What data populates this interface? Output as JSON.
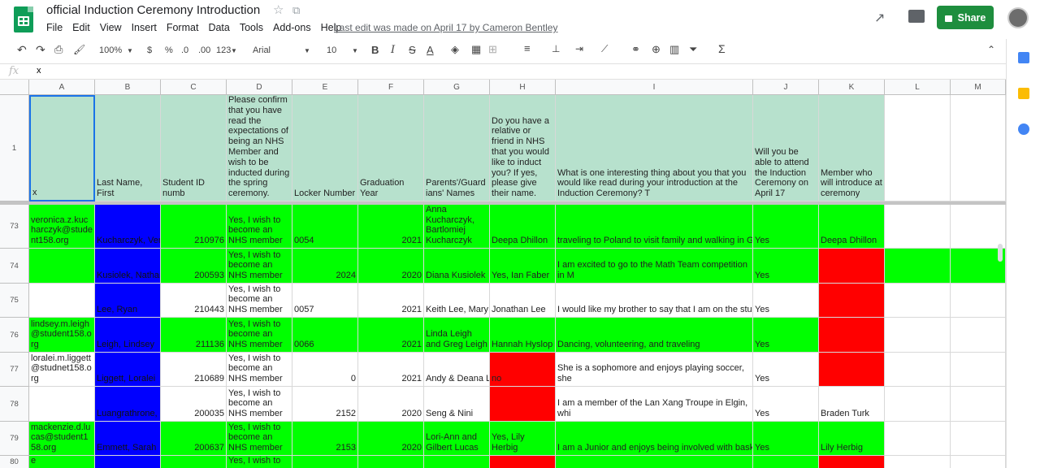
{
  "app": {
    "title": "official Induction Ceremony Introduction",
    "last_edit": "Last edit was made on April 17 by Cameron Bentley",
    "share_label": "Share"
  },
  "menu": [
    "File",
    "Edit",
    "View",
    "Insert",
    "Format",
    "Data",
    "Tools",
    "Add-ons",
    "Help"
  ],
  "toolbar": {
    "zoom": "100%",
    "currency": "$",
    "percent": "%",
    "dec_less": ".0",
    "dec_more": ".00",
    "format_more": "123",
    "font": "Arial",
    "size": "10"
  },
  "formula": {
    "label": "fx",
    "value": "x"
  },
  "columns": [
    "A",
    "B",
    "C",
    "D",
    "E",
    "F",
    "G",
    "H",
    "I",
    "J",
    "K",
    "L",
    "M"
  ],
  "header_row": {
    "num": "1",
    "cells": [
      "x",
      "Last Name, First",
      "Student ID numb",
      "Please confirm that you have read the expectations of being an NHS Member and wish to be inducted during the spring ceremony.",
      "Locker Number",
      "Graduation Year",
      "Parents'/Guardians' Names",
      "Do you have a relative or friend in NHS that you would like to induct you? If yes, please give their name.",
      "What is one interesting thing about you that you would like read during your introduction at the Induction Ceremony? T",
      "Will you be able to attend the Induction Ceremony on April 17",
      "Member who will introduce at ceremony",
      "",
      ""
    ]
  },
  "rows": [
    {
      "num": "73",
      "cells": [
        "veronica.z.kucharczyk@student158.org",
        "Kucharczyk, Ver",
        "210976",
        "Yes, I wish to become an NHS member",
        "0054",
        "2021",
        "Anna Kucharczyk, Bartlomiej Kucharczyk",
        "Deepa Dhillon",
        "traveling to Poland to visit family and walking in Gdynia along the beach in the sunset.",
        "Yes",
        "Deepa Dhillon",
        "",
        ""
      ]
    },
    {
      "num": "74",
      "cells": [
        "",
        "Kusiolek, Nathan",
        "200593",
        "Yes, I wish to become an NHS member",
        "2024",
        "2020",
        "Diana Kusiolek",
        "Yes, Ian Faber",
        "I am excited to go to the Math Team competition in M",
        "Yes",
        "",
        "",
        ""
      ]
    },
    {
      "num": "75",
      "cells": [
        "",
        "Lee, Ryan",
        "210443",
        "Yes, I wish to become an NHS member",
        "0057",
        "2021",
        "Keith Lee, Mary L",
        "Jonathan Lee",
        "I would like my brother to say that I am on the studen",
        "Yes",
        "",
        "",
        ""
      ]
    },
    {
      "num": "76",
      "cells": [
        "lindsey.m.leigh@student158.org",
        "Leigh, Lindsey",
        "211136",
        "Yes, I wish to become an NHS member",
        "0066",
        "2021",
        "Linda Leigh and Greg Leigh",
        "Hannah Hyslop",
        "Dancing, volunteering, and traveling",
        "Yes",
        "",
        "",
        ""
      ]
    },
    {
      "num": "77",
      "cells": [
        "loralei.m.liggett@studnet158.org",
        "Liggett, Loralei",
        "210689",
        "Yes, I wish to become an NHS member",
        "0",
        "2021",
        "Andy & Deana Li",
        "no",
        "She is a sophomore and enjoys playing soccer, she",
        "Yes",
        "",
        "",
        ""
      ]
    },
    {
      "num": "78",
      "cells": [
        "",
        "Luangrathrone, Pa",
        "200035",
        "Yes, I wish to become an NHS member",
        "2152",
        "2020",
        "Seng & Nini",
        "",
        "I am a member of the Lan Xang Troupe in Elgin, whi",
        "Yes",
        "Braden Turk",
        "",
        ""
      ]
    },
    {
      "num": "79",
      "cells": [
        "mackenzie.d.lucas@student158.org",
        "Emmett, Sarah",
        "200637",
        "Yes, I wish to become an NHS member",
        "2153",
        "2020",
        "Lori-Ann and Gilbert Lucas",
        "Yes, Lily Herbig",
        "I am a Junior and enjoys being involved with basketball, Link Crew, and volunteering whenever possible.",
        "Yes",
        "Lily Herbig",
        "",
        ""
      ]
    },
    {
      "num": "80",
      "cells": [
        "makayla.madse",
        "",
        "",
        "Yes, I wish to",
        "",
        "",
        "",
        "",
        "",
        "",
        "",
        "",
        ""
      ]
    }
  ],
  "colors": {
    "header_fill": "#b7e1cd",
    "green": "#00ff00",
    "red": "#ff0000",
    "blue": "#0000ff",
    "white": "#ffffff"
  }
}
